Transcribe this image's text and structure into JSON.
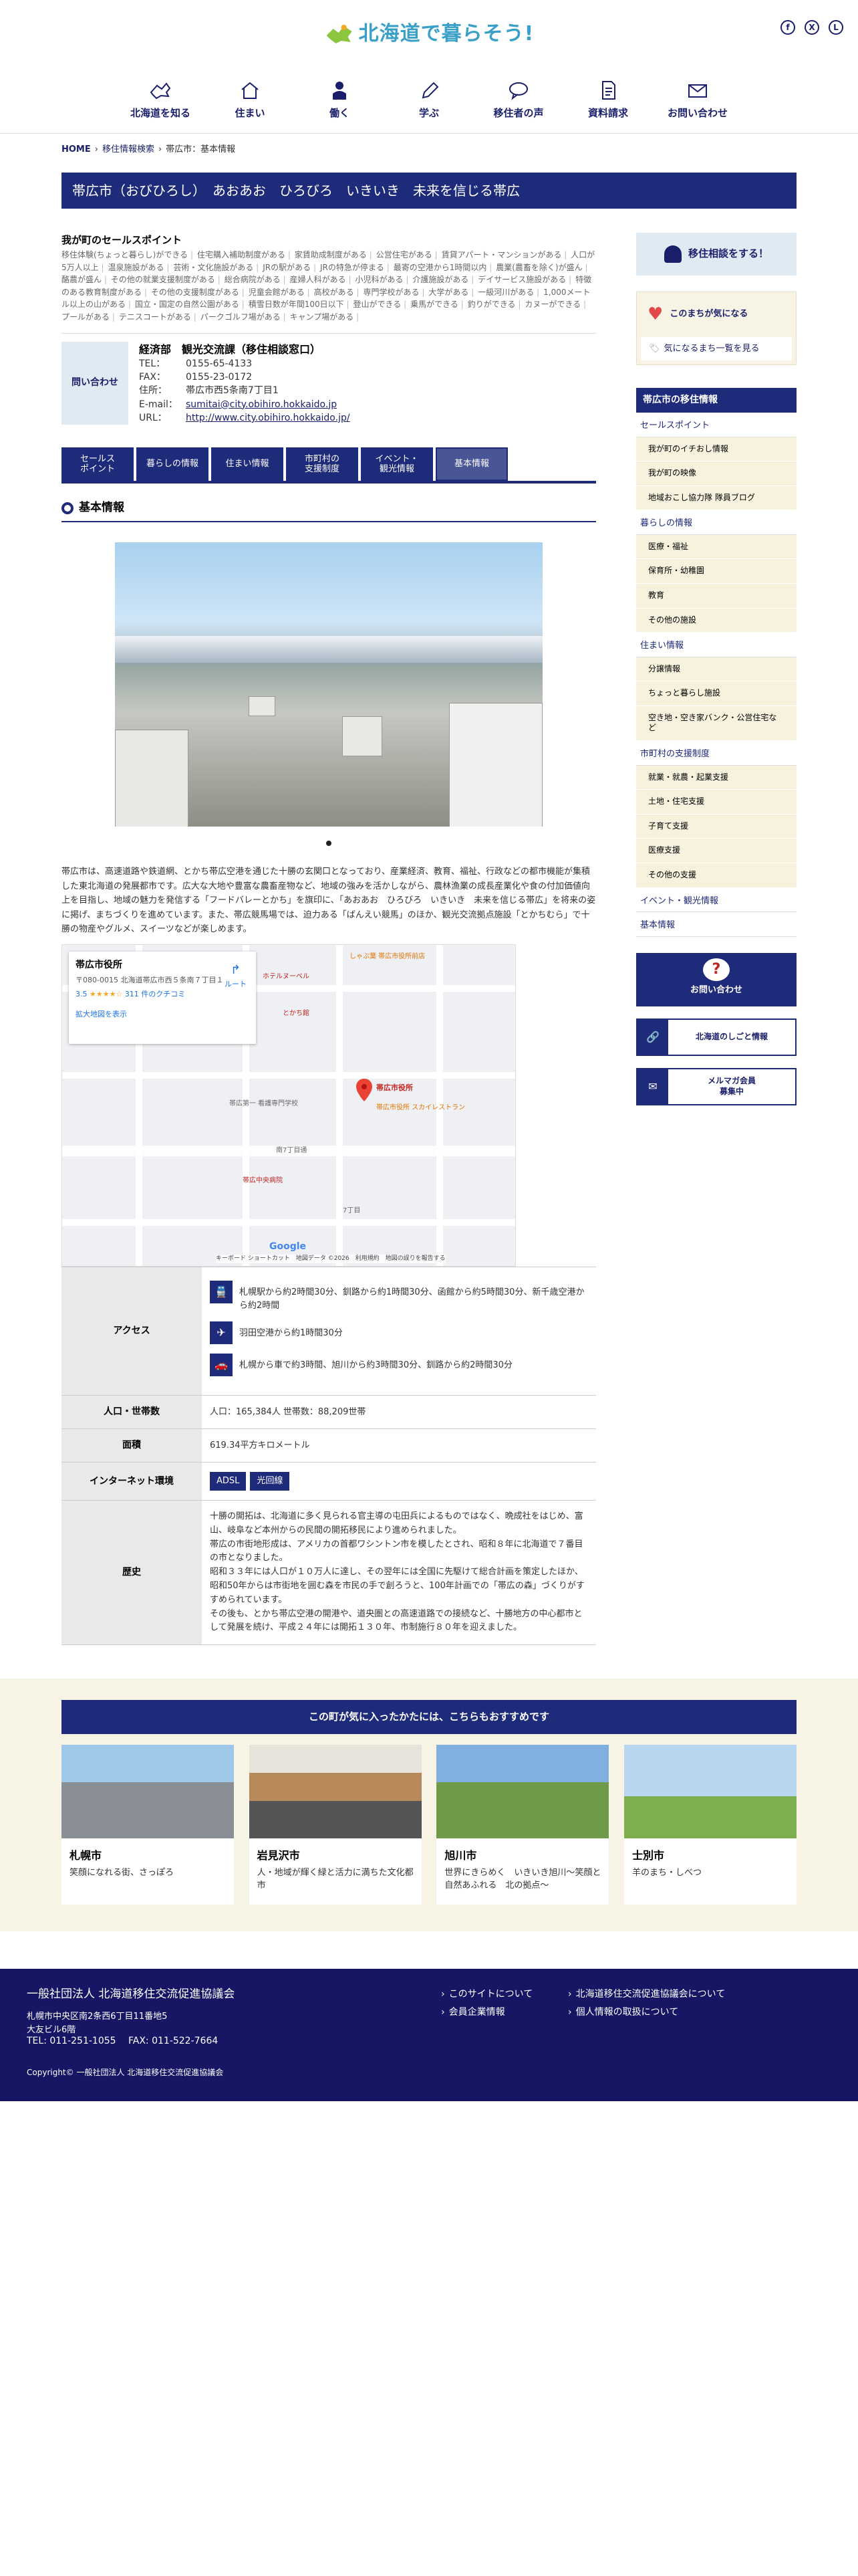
{
  "header": {
    "logo_text": "北海道で暮らそう!",
    "sns": [
      {
        "icon": "facebook-icon",
        "glyph": "f"
      },
      {
        "icon": "x-icon",
        "glyph": "X"
      },
      {
        "icon": "line-icon",
        "glyph": "L"
      }
    ],
    "nav": [
      {
        "label": "北海道を知る",
        "icon": "hokkaido-icon"
      },
      {
        "label": "住まい",
        "icon": "house-icon"
      },
      {
        "label": "働く",
        "icon": "worker-icon"
      },
      {
        "label": "学ぶ",
        "icon": "pencil-icon"
      },
      {
        "label": "移住者の声",
        "icon": "chat-icon"
      },
      {
        "label": "資料請求",
        "icon": "document-icon"
      },
      {
        "label": "お問い合わせ",
        "icon": "mail-icon"
      }
    ]
  },
  "breadcrumb": {
    "home": "HOME",
    "mid": "移住情報検索",
    "current": "帯広市：基本情報"
  },
  "page_title": "帯広市（おびひろし）　あおあお　ひろびろ　いきいき　未来を信じる帯広",
  "selling": {
    "heading": "我が町のセールスポイント",
    "points": [
      "移住体験(ちょっと暮らし)ができる",
      "住宅購入補助制度がある",
      "家賃助成制度がある",
      "公営住宅がある",
      "賃貸アパート・マンションがある",
      "人口が5万人以上",
      "温泉施設がある",
      "芸術・文化施設がある",
      "JRの駅がある",
      "JRの特急が停まる",
      "最寄の空港から1時間以内",
      "農業(農畜を除く)が盛ん",
      "酪農が盛ん",
      "その他の就業支援制度がある",
      "総合病院がある",
      "産婦人科がある",
      "小児科がある",
      "介護施設がある",
      "デイサービス施設がある",
      "特徴のある教育制度がある",
      "その他の支援制度がある",
      "児童会館がある",
      "高校がある",
      "専門学校がある",
      "大学がある",
      "一級河川がある",
      "1,000メートル以上の山がある",
      "国立・国定の自然公園がある",
      "積雪日数が年間100日以下",
      "登山ができる",
      "乗馬ができる",
      "釣りができる",
      "カヌーができる",
      "プールがある",
      "テニスコートがある",
      "パークゴルフ場がある",
      "キャンプ場がある"
    ]
  },
  "contact": {
    "label": "問い合わせ",
    "org": "経済部　観光交流課（移住相談窓口）",
    "tel_k": "TEL：",
    "tel": "0155-65-4133",
    "fax_k": "FAX：",
    "fax": "0155-23-0172",
    "addr_k": "住所：",
    "addr": "帯広市西5条南7丁目1",
    "mail_k": "E-mail：",
    "mail": "sumitai@city.obihiro.hokkaido.jp",
    "url_k": "URL：",
    "url": "http://www.city.obihiro.hokkaido.jp/"
  },
  "tabs": [
    "セールス\nポイント",
    "暮らしの情報",
    "住まい情報",
    "市町村の\n支援制度",
    "イベント・\n観光情報",
    "基本情報"
  ],
  "section_title": "基本情報",
  "intro": "帯広市は、高速道路や鉄道網、とかち帯広空港を通じた十勝の玄関口となっており、産業経済、教育、福祉、行政などの都市機能が集積した東北海道の発展都市です。広大な大地や豊富な農畜産物など、地域の強みを活かしながら、農林漁業の成長産業化や食の付加価値向上を目指し、地域の魅力を発信する「フードバレーとかち」を旗印に、「あおあお　ひろびろ　いきいき　未来を信じる帯広」を将来の姿に掲げ、まちづくりを進めています。また、帯広競馬場では、迫力ある「ばんえい競馬」のほか、観光交流拠点施設「とかちむら」で十勝の物産やグルメ、スイーツなどが楽しめます。",
  "map": {
    "place": "帯広市役所",
    "address": "〒080-0015 北海道帯広市西５条南７丁目１",
    "rating": "3.5",
    "stars": "★★★★☆",
    "reviews": "311 件のクチコミ",
    "route": "ルート",
    "enlarge": "拡大地図を表示",
    "pin_label": "帯広市役所",
    "labels": [
      "しゃぶ葉 帯広市役所前店",
      "ホテルヌーベル",
      "とかち館",
      "帯広中央病院",
      "7丁目",
      "南7丁目通",
      "帯広市役所 スカイレストラン",
      "帯広第一 看護専門学校"
    ],
    "google": "Google",
    "footer": "キーボード ショートカット　地図データ ©2026　利用規約　地図の誤りを報告する"
  },
  "info": {
    "access_h": "アクセス",
    "access": [
      {
        "icon": "train-icon",
        "glyph": "🚆",
        "text": "札幌駅から約2時間30分、釧路から約1時間30分、函館から約5時間30分、新千歳空港から約2時間"
      },
      {
        "icon": "airplane-icon",
        "glyph": "✈",
        "text": "羽田空港から約1時間30分"
      },
      {
        "icon": "car-icon",
        "glyph": "🚗",
        "text": "札幌から車で約3時間、旭川から約3時間30分、釧路から約2時間30分"
      }
    ],
    "pop_h": "人口・世帯数",
    "pop": "人口：165,384人 世帯数：88,209世帯",
    "area_h": "面積",
    "area": "619.34平方キロメートル",
    "net_h": "インターネット環境",
    "net": [
      "ADSL",
      "光回線"
    ],
    "hist_h": "歴史",
    "hist": [
      "十勝の開拓は、北海道に多く見られる官主導の屯田兵によるものではなく、晩成社をはじめ、富山、岐阜など本州からの民間の開拓移民により進められました。",
      "帯広の市街地形成は、アメリカの首都ワシントン市を模したとされ、昭和８年に北海道で７番目の市となりました。",
      "昭和３３年には人口が１０万人に達し、その翌年には全国に先駆けて総合計画を策定したほか、昭和50年からは市街地を囲む森を市民の手で創ろうと、100年計画での「帯広の森」づくりがすすめられています。",
      "その後も、とかち帯広空港の開港や、道央圏との高速道路での接続など、十勝地方の中心都市として発展を続け、平成２４年には開拓１３０年、市制施行８０年を迎えました。"
    ]
  },
  "recommend": {
    "heading": "この町が気に入ったかたには、こちらもおすすめです",
    "cards": [
      {
        "title": "札幌市",
        "desc": "笑顔になれる街、さっぽろ"
      },
      {
        "title": "岩見沢市",
        "desc": "人・地域が輝く緑と活力に満ちた文化都市"
      },
      {
        "title": "旭川市",
        "desc": "世界にきらめく　いきいき旭川〜笑顔と自然あふれる　北の拠点〜"
      },
      {
        "title": "士別市",
        "desc": "羊のまち・しべつ"
      }
    ]
  },
  "side": {
    "consult_btn": "移住相談をする！",
    "fav_top": "このまちが気になる",
    "fav_list": "気になるまち一覧を見る",
    "nav_h": "帯広市の移住情報",
    "nav": [
      {
        "cat": "セールスポイント",
        "items": [
          "我が町のイチおし情報",
          "我が町の映像",
          "地域おこし協力隊 隊員ブログ"
        ]
      },
      {
        "cat": "暮らしの情報",
        "items": [
          "医療・福祉",
          "保育所・幼稚園",
          "教育",
          "その他の施設"
        ]
      },
      {
        "cat": "住まい情報",
        "items": [
          "分譲情報",
          "ちょっと暮らし施設",
          "空き地・空き家バンク・公営住宅など"
        ]
      },
      {
        "cat": "市町村の支援制度",
        "items": [
          "就業・就農・起業支援",
          "土地・住宅支援",
          "子育て支援",
          "医療支援",
          "その他の支援"
        ]
      },
      {
        "cat": "イベント・観光情報",
        "items": []
      },
      {
        "cat": "基本情報",
        "items": []
      }
    ],
    "consult2": "お問い合わせ",
    "link1": "北海道のしごと情報",
    "link2": "メルマガ会員\n募集中"
  },
  "footer": {
    "org": "一般社団法人 北海道移住交流促進協議会",
    "addr1": "札幌市中央区南2条西6丁目11番地5",
    "addr2": "大友ビル6階",
    "tel": "TEL: 011-251-1055　 FAX: 011-522-7664",
    "links": [
      "このサイトについて",
      "北海道移住交流促進協議会について",
      "会員企業情報",
      "個人情報の取扱について"
    ],
    "copyright": "Copyright© 一般社団法人 北海道移住交流促進協議会"
  }
}
